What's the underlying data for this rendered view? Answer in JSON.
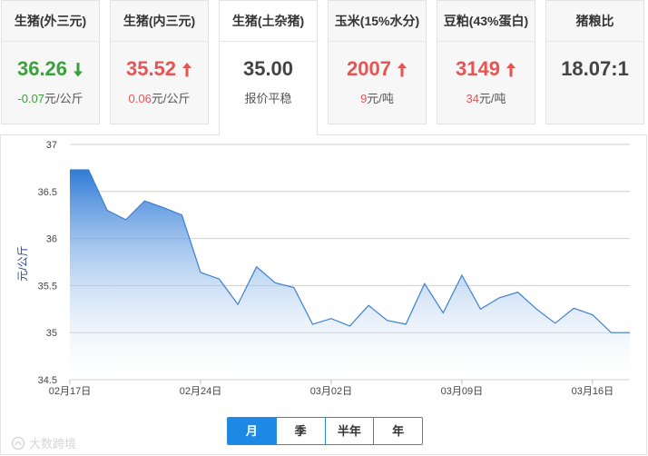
{
  "cards": [
    {
      "title": "生猪(外三元)",
      "value": "36.26",
      "direction": "down",
      "change": "-0.07",
      "unit": "元/公斤"
    },
    {
      "title": "生猪(内三元)",
      "value": "35.52",
      "direction": "up",
      "change": "0.06",
      "unit": "元/公斤"
    },
    {
      "title": "生猪(土杂猪)",
      "value": "35.00",
      "direction": "flat",
      "status": "报价平稳"
    },
    {
      "title": "玉米(15%水分)",
      "value": "2007",
      "direction": "up",
      "change": "9",
      "unit": "元/吨"
    },
    {
      "title": "豆粕(43%蛋白)",
      "value": "3149",
      "direction": "up",
      "change": "34",
      "unit": "元/吨"
    },
    {
      "title": "猪粮比",
      "value": "18.07:1",
      "direction": "flat"
    }
  ],
  "periods": {
    "month": "月",
    "quarter": "季",
    "half_year": "半年",
    "year": "年",
    "active": "month"
  },
  "watermark": "大数跨境",
  "colors": {
    "up": "#e85454",
    "down": "#3aa13c",
    "line": "#3a7fcf",
    "area_top": "#2f7bd6",
    "area_bottom": "#ffffff",
    "period_active": "#1e88e5"
  },
  "chart_data": {
    "type": "area",
    "ylabel": "元/公斤",
    "ylim": [
      34.5,
      37
    ],
    "yticks": [
      "37",
      "36.5",
      "36",
      "35.5",
      "35",
      "34.5"
    ],
    "xticks": [
      {
        "index": 0,
        "label": "02月17日"
      },
      {
        "index": 7,
        "label": "02月24日"
      },
      {
        "index": 14,
        "label": "03月02日"
      },
      {
        "index": 21,
        "label": "03月09日"
      },
      {
        "index": 28,
        "label": "03月16日"
      }
    ],
    "grid": true,
    "series": [
      {
        "values": [
          36.73,
          36.73,
          36.3,
          36.2,
          36.4,
          36.33,
          36.25,
          35.64,
          35.57,
          35.3,
          35.7,
          35.53,
          35.48,
          35.09,
          35.15,
          35.07,
          35.29,
          35.13,
          35.09,
          35.52,
          35.21,
          35.61,
          35.25,
          35.37,
          35.43,
          35.25,
          35.1,
          35.26,
          35.19,
          35.0,
          35.0
        ]
      }
    ]
  }
}
